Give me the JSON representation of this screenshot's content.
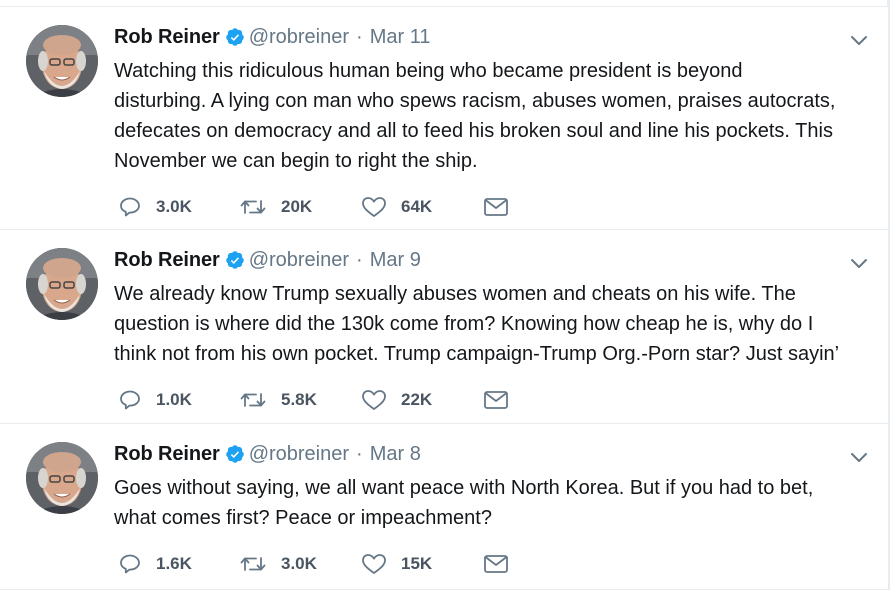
{
  "author": {
    "name": "Rob Reiner",
    "handle": "@robreiner",
    "avatar_icon": "profile-photo",
    "verified_icon": "verified-badge-icon",
    "verified_color": "#1da1f2"
  },
  "colors": {
    "text": "#14171a",
    "muted": "#657786",
    "icon": "#657786",
    "divider": "#e6ecf0"
  },
  "tweets": [
    {
      "date": "Mar 11",
      "text": "Watching this ridiculous human being who became president is beyond\ndisturbing. A lying con man who spews racism, abuses women, praises autocrats,\ndefecates on democracy and all to feed his broken soul and line his pockets. This\nNovember we can begin to right the ship.",
      "replies": "3.0K",
      "retweets": "20K",
      "likes": "64K"
    },
    {
      "date": "Mar 9",
      "text": "We already know Trump sexually abuses women and cheats on his wife. The\nquestion is where did the 130k come from? Knowing how cheap he is, why do I\nthink not from his own pocket. Trump campaign-Trump Org.-Porn star? Just sayin’",
      "replies": "1.0K",
      "retweets": "5.8K",
      "likes": "22K"
    },
    {
      "date": "Mar 8",
      "text": "Goes without saying, we all want peace with North Korea. But if you had to bet,\nwhat comes first? Peace or impeachment?",
      "replies": "1.6K",
      "retweets": "3.0K",
      "likes": "15K"
    }
  ],
  "separator": "·"
}
